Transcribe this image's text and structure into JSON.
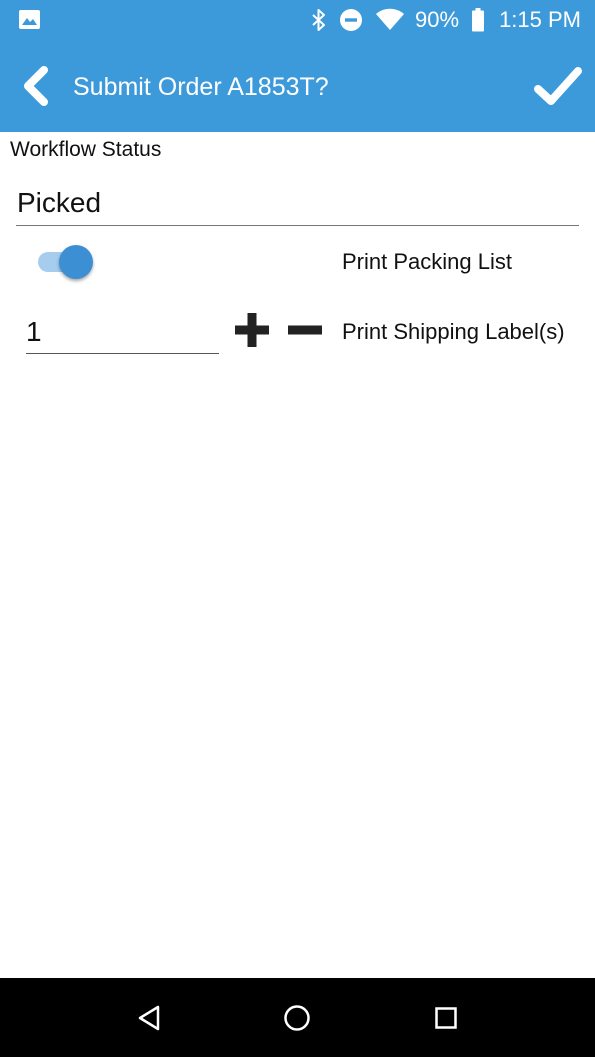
{
  "status_bar": {
    "battery_percent": "90%",
    "time": "1:15 PM",
    "icons": [
      "image-icon",
      "bluetooth-icon",
      "do-not-disturb-icon",
      "wifi-icon",
      "battery-icon"
    ]
  },
  "app_bar": {
    "title": "Submit Order A1853T?",
    "back_icon": "chevron-left-icon",
    "confirm_icon": "checkmark-icon"
  },
  "form": {
    "workflow_label": "Workflow Status",
    "workflow_value": "Picked",
    "print_packing_list": {
      "label": "Print Packing List",
      "enabled": true
    },
    "shipping_labels": {
      "quantity": "1",
      "label": "Print Shipping Label(s)",
      "increment_icon": "plus-icon",
      "decrement_icon": "minus-icon"
    }
  },
  "nav_bar": {
    "icons": [
      "triangle-back-icon",
      "circle-home-icon",
      "square-recents-icon"
    ]
  },
  "colors": {
    "primary": "#3d9ada",
    "switch_thumb": "#3d8fd4",
    "switch_track": "#a6cdee",
    "nav_background": "#000000"
  }
}
